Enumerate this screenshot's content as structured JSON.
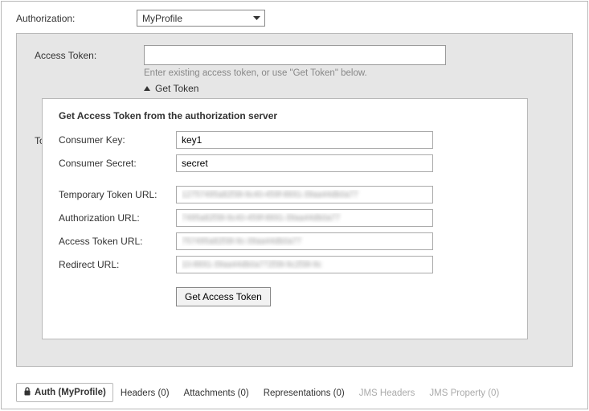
{
  "authorizationLabel": "Authorization:",
  "profileSelected": "MyProfile",
  "panel": {
    "accessTokenLabel": "Access Token:",
    "accessTokenValue": "",
    "accessTokenHint": "Enter existing access token, or use \"Get Token\" below.",
    "getTokenToggle": "Get Token",
    "tokenSecretPartial": "To"
  },
  "popup": {
    "title": "Get Access Token from the authorization server",
    "consumerKeyLabel": "Consumer Key:",
    "consumerKeyValue": "key1",
    "consumerSecretLabel": "Consumer Secret:",
    "consumerSecretValue": "secret",
    "tempTokenUrlLabel": "Temporary Token URL:",
    "tempTokenUrlValue": "12757495a82f38-9c40-459f-8691-39aa44db0a77",
    "authUrlLabel": "Authorization URL:",
    "authUrlValue": "7495a82f38-9c40-459f-8691-39aa44db0a77",
    "accessTokenUrlLabel": "Access Token URL:",
    "accessTokenUrlValue": "757495a82f38-9c-39aa44db0a77",
    "redirectUrlLabel": "Redirect URL:",
    "redirectUrlValue": "10-8691-39aa44db0a772f38-9c2f38-9c",
    "getAccessTokenButton": "Get Access Token"
  },
  "tabs": {
    "auth": "Auth (MyProfile)",
    "headers": "Headers (0)",
    "attachments": "Attachments (0)",
    "representations": "Representations (0)",
    "jmsHeaders": "JMS Headers",
    "jmsProperty": "JMS Property (0)"
  }
}
